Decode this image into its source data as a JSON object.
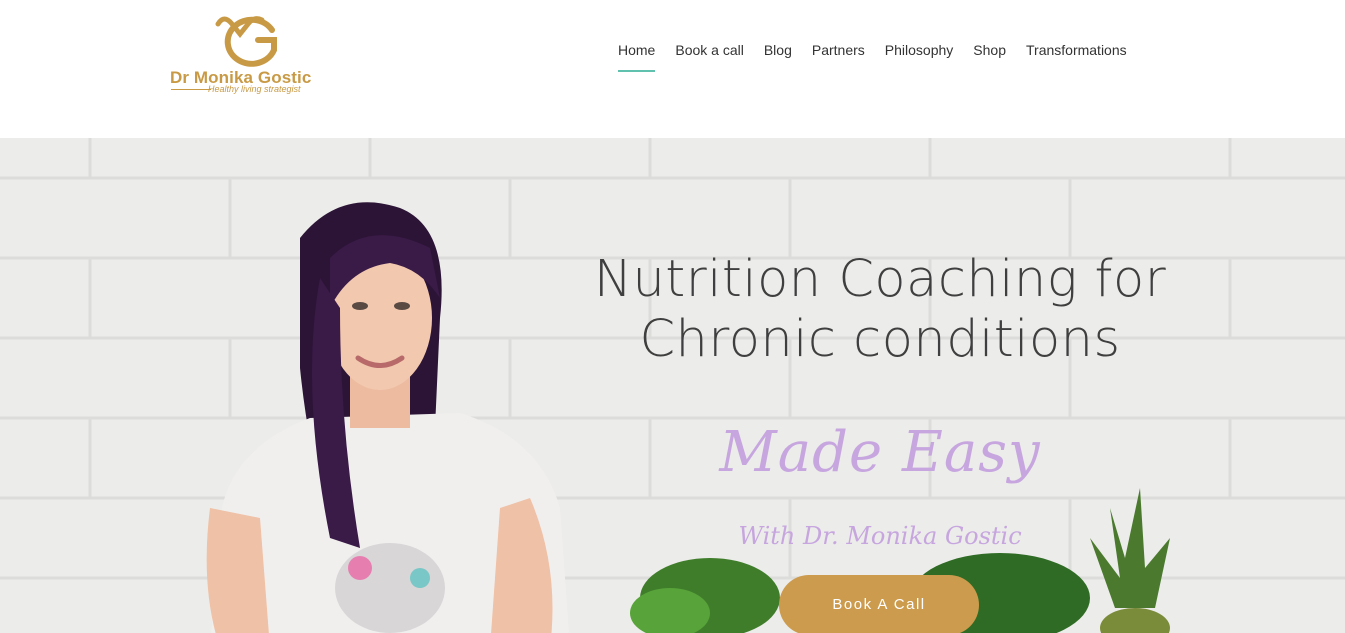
{
  "brand": {
    "name": "Dr Monika Gostic",
    "tagline": "Healthy living strategist",
    "color": "#c99a45"
  },
  "nav": {
    "items": [
      {
        "label": "Home",
        "active": true
      },
      {
        "label": "Book a call"
      },
      {
        "label": "Blog"
      },
      {
        "label": "Partners"
      },
      {
        "label": "Philosophy"
      },
      {
        "label": "Shop"
      },
      {
        "label": "Transformations"
      }
    ],
    "active_color": "#5fc1ae"
  },
  "hero": {
    "title_line1": "Nutrition Coaching for",
    "title_line2": "Chronic conditions",
    "made_easy": "Made Easy",
    "with": "With Dr. Monika Gostic",
    "cta_label": "Book A Call",
    "cta_color": "#cc9b4d",
    "accent_color": "#c7a6df"
  }
}
